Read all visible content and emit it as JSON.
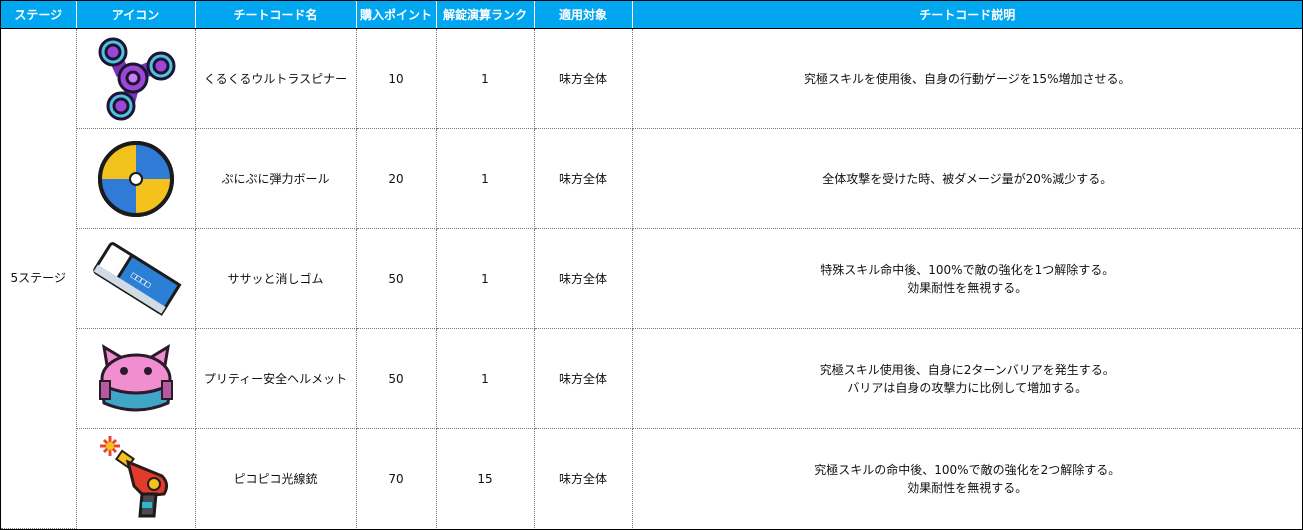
{
  "headers": {
    "stage": "ステージ",
    "icon": "アイコン",
    "name": "チートコード名",
    "points": "購入ポイント",
    "rank": "解錠演算ランク",
    "target": "適用対象",
    "description": "チートコード説明"
  },
  "stage_label": "5ステージ",
  "rows": [
    {
      "icon": "fidget-spinner-icon",
      "name": "くるくるウルトラスピナー",
      "points": "10",
      "rank": "1",
      "target": "味方全体",
      "description": [
        "究極スキルを使用後、自身の行動ゲージを15%増加させる。"
      ]
    },
    {
      "icon": "beach-ball-icon",
      "name": "ぷにぷに弾力ボール",
      "points": "20",
      "rank": "1",
      "target": "味方全体",
      "description": [
        "全体攻撃を受けた時、被ダメージ量が20%減少する。"
      ]
    },
    {
      "icon": "eraser-icon",
      "name": "ササッと消しゴム",
      "points": "50",
      "rank": "1",
      "target": "味方全体",
      "description": [
        "特殊スキル命中後、100%で敵の強化を1つ解除する。",
        "効果耐性を無視する。"
      ]
    },
    {
      "icon": "cat-helmet-icon",
      "name": "プリティー安全ヘルメット",
      "points": "50",
      "rank": "1",
      "target": "味方全体",
      "description": [
        "究極スキル使用後、自身に2ターンバリアを発生する。",
        "バリアは自身の攻撃力に比例して増加する。"
      ]
    },
    {
      "icon": "ray-gun-icon",
      "name": "ピコピコ光線銃",
      "points": "70",
      "rank": "15",
      "target": "味方全体",
      "description": [
        "究極スキルの命中後、100%で敵の強化を2つ解除する。",
        "効果耐性を無視する。"
      ]
    }
  ]
}
